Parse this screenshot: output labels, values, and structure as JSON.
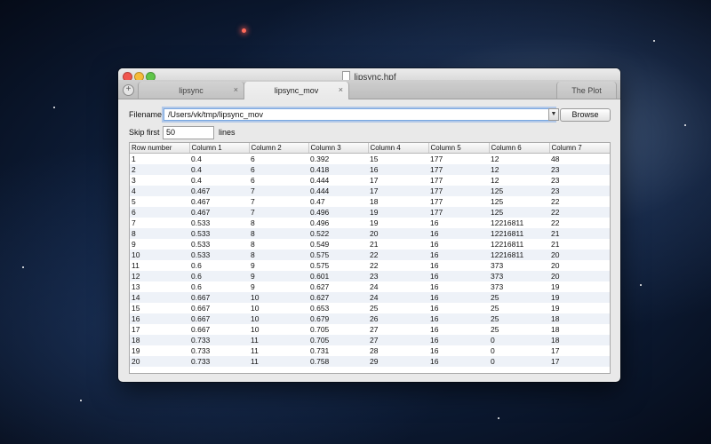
{
  "window": {
    "title": "lipsync.hpf"
  },
  "tabs": [
    {
      "label": "lipsync",
      "close": "×"
    },
    {
      "label": "lipsync_mov",
      "close": "×"
    },
    {
      "label": "The Plot"
    }
  ],
  "add_tab": "+",
  "filename": {
    "label": "Filename",
    "value": "/Users/vk/tmp/lipsync_mov",
    "browse": "Browse"
  },
  "skip": {
    "label": "Skip first",
    "value": "50",
    "suffix": "lines"
  },
  "table": {
    "columns": [
      "Row number",
      "Column 1",
      "Column 2",
      "Column 3",
      "Column 4",
      "Column 5",
      "Column 6",
      "Column 7"
    ],
    "rows": [
      [
        "1",
        "0.4",
        "6",
        "0.392",
        "15",
        "177",
        "12",
        "48"
      ],
      [
        "2",
        "0.4",
        "6",
        "0.418",
        "16",
        "177",
        "12",
        "23"
      ],
      [
        "3",
        "0.4",
        "6",
        "0.444",
        "17",
        "177",
        "12",
        "23"
      ],
      [
        "4",
        "0.467",
        "7",
        "0.444",
        "17",
        "177",
        "125",
        "23"
      ],
      [
        "5",
        "0.467",
        "7",
        "0.47",
        "18",
        "177",
        "125",
        "22"
      ],
      [
        "6",
        "0.467",
        "7",
        "0.496",
        "19",
        "177",
        "125",
        "22"
      ],
      [
        "7",
        "0.533",
        "8",
        "0.496",
        "19",
        "16",
        "12216811",
        "22"
      ],
      [
        "8",
        "0.533",
        "8",
        "0.522",
        "20",
        "16",
        "12216811",
        "21"
      ],
      [
        "9",
        "0.533",
        "8",
        "0.549",
        "21",
        "16",
        "12216811",
        "21"
      ],
      [
        "10",
        "0.533",
        "8",
        "0.575",
        "22",
        "16",
        "12216811",
        "20"
      ],
      [
        "11",
        "0.6",
        "9",
        "0.575",
        "22",
        "16",
        "373",
        "20"
      ],
      [
        "12",
        "0.6",
        "9",
        "0.601",
        "23",
        "16",
        "373",
        "20"
      ],
      [
        "13",
        "0.6",
        "9",
        "0.627",
        "24",
        "16",
        "373",
        "19"
      ],
      [
        "14",
        "0.667",
        "10",
        "0.627",
        "24",
        "16",
        "25",
        "19"
      ],
      [
        "15",
        "0.667",
        "10",
        "0.653",
        "25",
        "16",
        "25",
        "19"
      ],
      [
        "16",
        "0.667",
        "10",
        "0.679",
        "26",
        "16",
        "25",
        "18"
      ],
      [
        "17",
        "0.667",
        "10",
        "0.705",
        "27",
        "16",
        "25",
        "18"
      ],
      [
        "18",
        "0.733",
        "11",
        "0.705",
        "27",
        "16",
        "0",
        "18"
      ],
      [
        "19",
        "0.733",
        "11",
        "0.731",
        "28",
        "16",
        "0",
        "17"
      ],
      [
        "20",
        "0.733",
        "11",
        "0.758",
        "29",
        "16",
        "0",
        "17"
      ]
    ]
  }
}
